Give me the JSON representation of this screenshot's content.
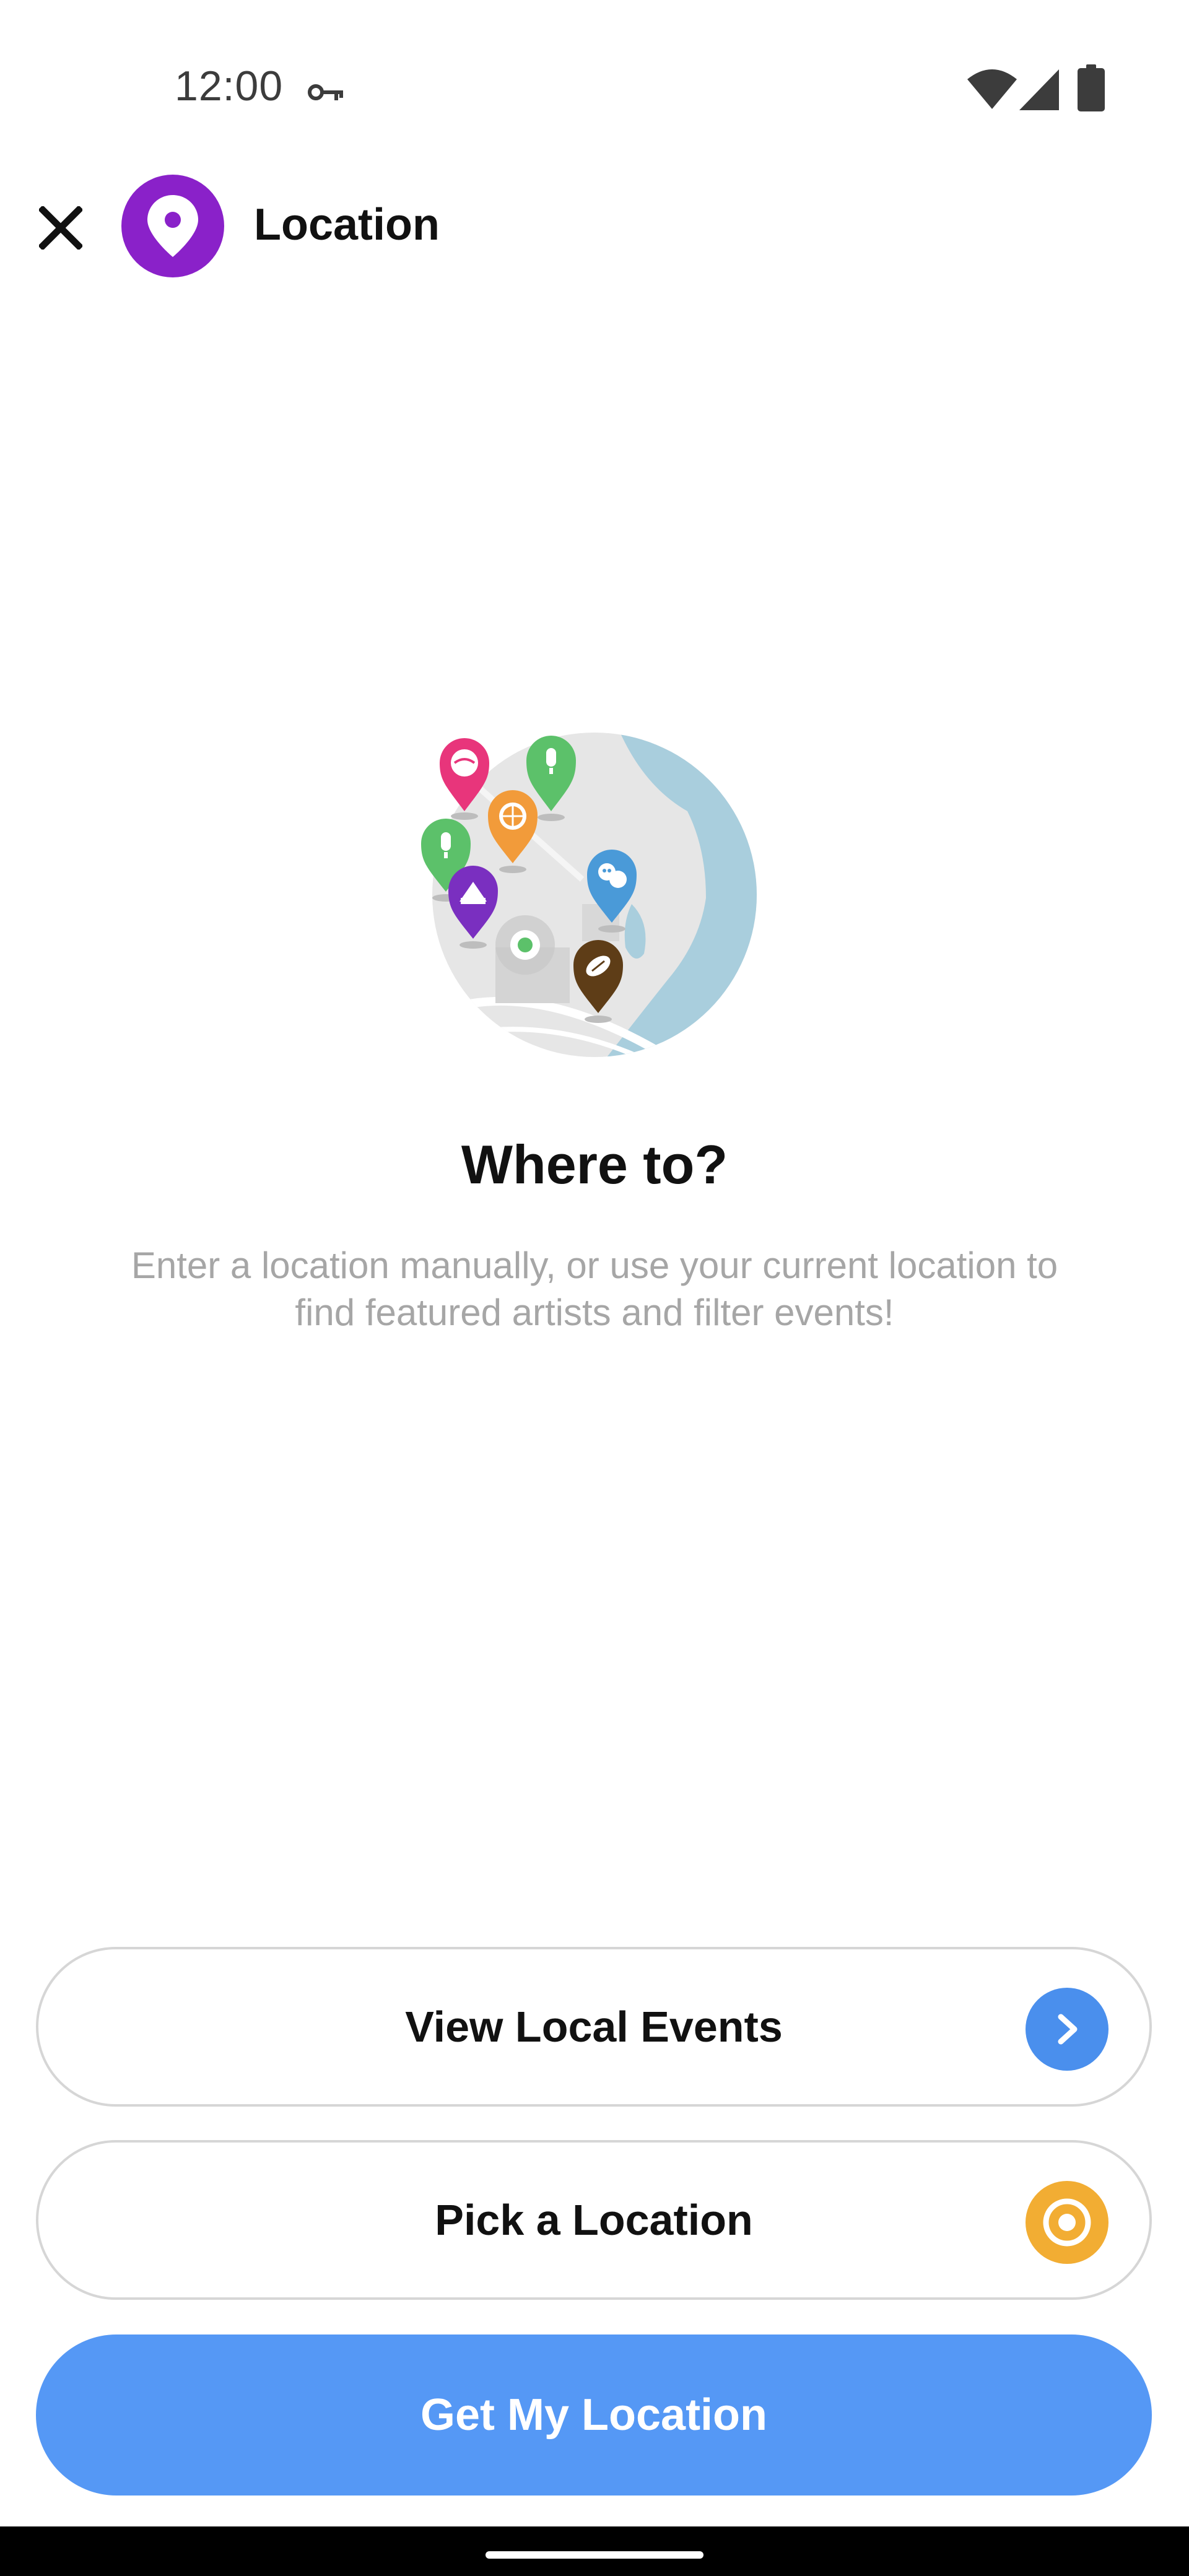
{
  "status_bar": {
    "time": "12:00",
    "icons": [
      "key-icon",
      "wifi-icon",
      "signal-icon",
      "battery-icon"
    ]
  },
  "app_bar": {
    "title": "Location",
    "close_icon": "close-icon",
    "avatar_icon": "location-pin-icon",
    "avatar_color": "#8a21c9"
  },
  "illustration": {
    "icon": "map-pins-illustration",
    "pins": [
      "baseball-pin",
      "microphone-pin",
      "basketball-pin",
      "microphone-pin",
      "theater-pin",
      "circus-tent-pin",
      "football-pin"
    ]
  },
  "main": {
    "headline": "Where to?",
    "description": "Enter a location manually, or use your current location to find featured artists and filter events!"
  },
  "buttons": {
    "view_local_events": {
      "label": "View Local Events",
      "icon": "chevron-right-icon",
      "icon_color": "#4a8fed"
    },
    "pick_location": {
      "label": "Pick a Location",
      "icon": "target-icon",
      "icon_color": "#f2ad33"
    },
    "get_my_location": {
      "label": "Get My Location",
      "color": "#5598f5"
    }
  }
}
